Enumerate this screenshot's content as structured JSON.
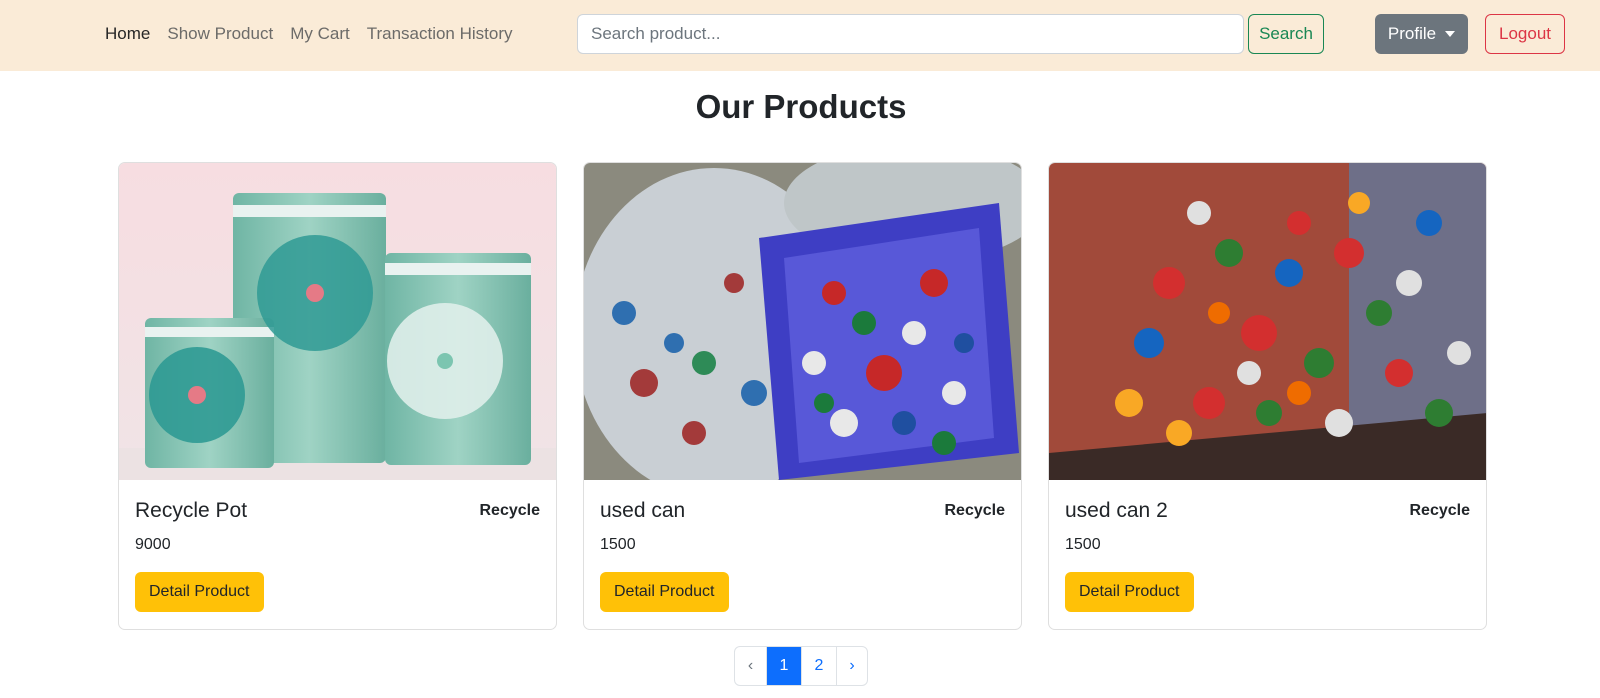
{
  "nav": {
    "links": [
      "Home",
      "Show Product",
      "My Cart",
      "Transaction History"
    ],
    "search_placeholder": "Search product...",
    "search_value": "",
    "search_label": "Search",
    "profile_label": "Profile",
    "logout_label": "Logout"
  },
  "main": {
    "title": "Our Products",
    "products": [
      {
        "name": "Recycle Pot",
        "category": "Recycle",
        "price": "9000",
        "button": "Detail Product"
      },
      {
        "name": "used can",
        "category": "Recycle",
        "price": "1500",
        "button": "Detail Product"
      },
      {
        "name": "used can 2",
        "category": "Recycle",
        "price": "1500",
        "button": "Detail Product"
      }
    ]
  },
  "pagination": {
    "prev": "‹",
    "pages": [
      "1",
      "2"
    ],
    "current": "1",
    "next": "›"
  },
  "colors": {
    "navbar_bg": "#faebd7",
    "primary": "#0d6efd",
    "warning": "#ffc107",
    "success": "#198754",
    "danger": "#dc3545",
    "secondary": "#6c757d"
  }
}
